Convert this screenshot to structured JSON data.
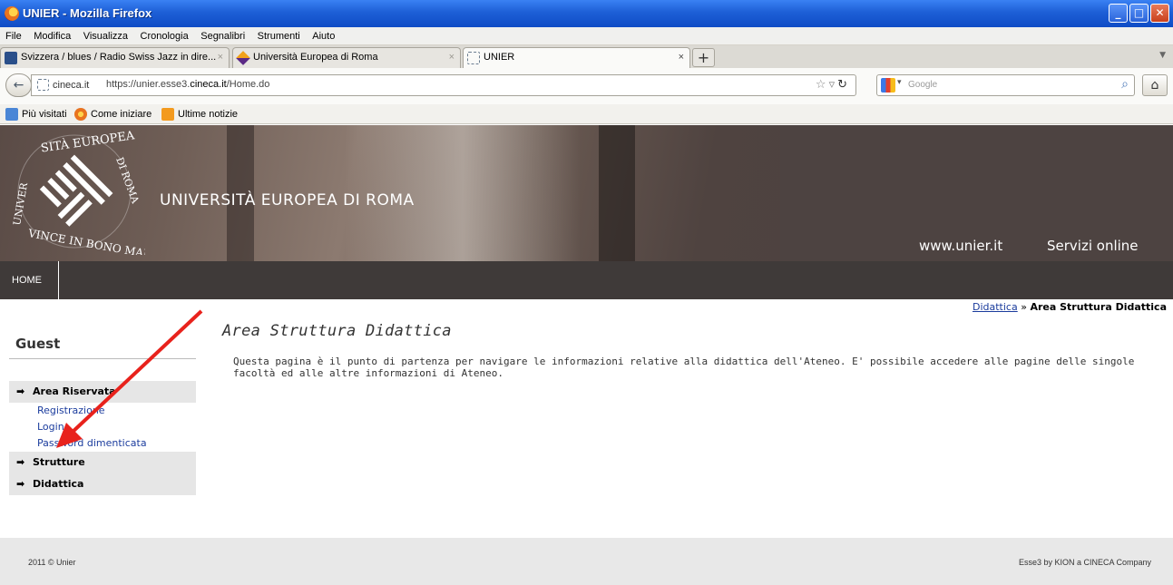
{
  "window": {
    "title": "UNIER - Mozilla Firefox",
    "minimize": "_",
    "maximize": "□",
    "close": "✕"
  },
  "menu": [
    "File",
    "Modifica",
    "Visualizza",
    "Cronologia",
    "Segnalibri",
    "Strumenti",
    "Aiuto"
  ],
  "tabs": [
    {
      "label": "Svizzera / blues / Radio Swiss Jazz in dire...",
      "close": "×",
      "icon": "rs-favicon"
    },
    {
      "label": "Università Europea di Roma",
      "close": "×",
      "icon": "uer-favicon"
    },
    {
      "label": "UNIER",
      "close": "×",
      "icon": "blank-page-icon"
    }
  ],
  "new_tab": "+",
  "navigation": {
    "back": "←",
    "site_identity": "cineca.it",
    "url_prefix": "https://unier.esse3.",
    "url_domain": "cineca.it",
    "url_suffix": "/Home.do",
    "search_placeholder": "Google",
    "home": "⌂"
  },
  "bookmarks": [
    "Più visitati",
    "Come iniziare",
    "Ultime notizie"
  ],
  "banner": {
    "university_name": "UNIVERSITÀ EUROPEA DI ROMA",
    "link_site": "www.unier.it",
    "link_services": "Servizi online"
  },
  "nav": {
    "home": "HOME"
  },
  "breadcrumb": {
    "parent": "Didattica",
    "separator": "»",
    "current": "Area Struttura Didattica"
  },
  "sidebar": {
    "user": "Guest",
    "sections": [
      {
        "label": "Area Riservata",
        "links": [
          "Registrazione",
          "Login",
          "Password dimenticata"
        ]
      },
      {
        "label": "Strutture",
        "links": []
      },
      {
        "label": "Didattica",
        "links": []
      }
    ]
  },
  "main": {
    "title": "Area Struttura Didattica",
    "description": "Questa pagina è il punto di partenza per navigare le informazioni relative alla didattica dell'Ateneo. E' possibile accedere alle pagine delle singole facoltà ed alle altre informazioni di Ateneo."
  },
  "footer": {
    "left": "2011 © Unier",
    "right": "Esse3 by KION a CINECA Company"
  },
  "colors": {
    "annotation_arrow": "#e8221c",
    "link": "#1c3d9e",
    "nav_bg": "#3f3a39"
  }
}
